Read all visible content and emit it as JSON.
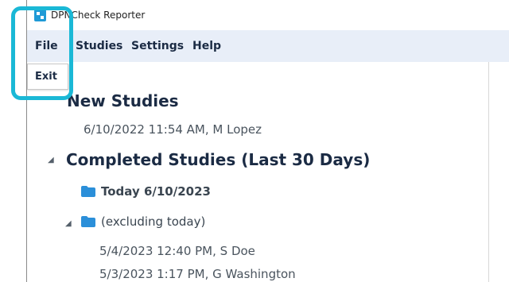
{
  "window": {
    "title": "DPNCheck Reporter"
  },
  "menubar": {
    "file": "File",
    "studies": "Studies",
    "settings": "Settings",
    "help": "Help"
  },
  "file_menu": {
    "exit": "Exit"
  },
  "tree": {
    "new_studies": {
      "label": "New Studies",
      "items": [
        "6/10/2022 11:54 AM, M Lopez"
      ]
    },
    "completed": {
      "label": "Completed Studies (Last 30 Days)",
      "today_folder": "Today 6/10/2023",
      "excluding_folder": "(excluding today)",
      "items": [
        "5/4/2023 12:40 PM, S Doe",
        "5/3/2023 1:17 PM, G Washington"
      ]
    }
  },
  "colors": {
    "accent": "#1ab8d6",
    "folder": "#2b8fd9",
    "menubar": "#e8eef8"
  }
}
